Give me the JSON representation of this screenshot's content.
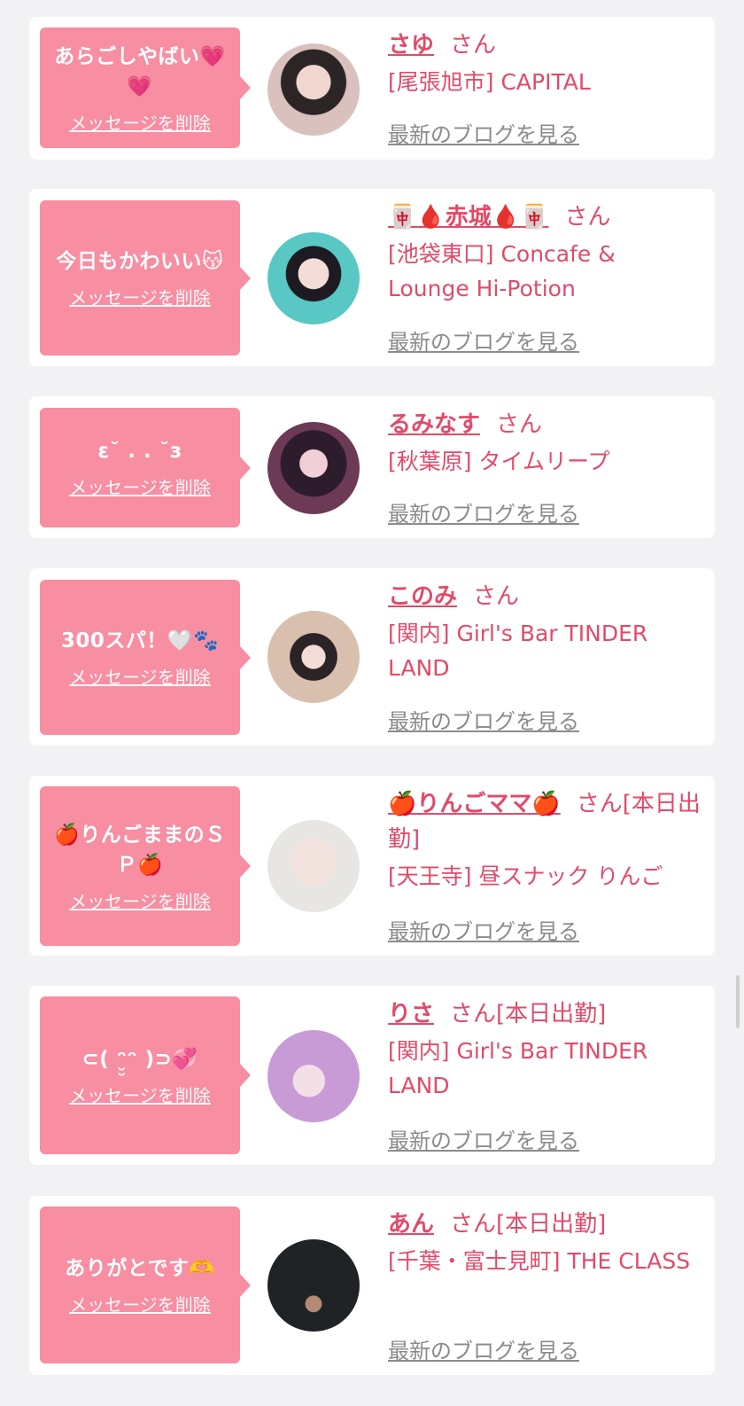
{
  "delete_label": "メッセージを削除",
  "blog_label": "最新のブログを見る",
  "san_label": "さん",
  "colors": {
    "accent": "#e14b6a",
    "bubble": "#f78ea2",
    "card": "#ffffff",
    "bg": "#f2f2f4"
  },
  "items": [
    {
      "message": "あらごしやばい💗💗",
      "name": "さゆ",
      "suffix": "",
      "shop": "[尾張旭市] CAPITAL"
    },
    {
      "message": "今日もかわいい😽",
      "name": "🀄🩸赤城🩸🀄",
      "suffix": "",
      "shop": "[池袋東口] Concafe & Lounge Hi-Potion"
    },
    {
      "message": "ε˘ . . ˘з",
      "name": "るみなす",
      "suffix": "",
      "shop": "[秋葉原] タイムリープ"
    },
    {
      "message": "300スパ！🤍🐾",
      "name": "このみ",
      "suffix": "",
      "shop": "[関内] Girl's Bar TINDER LAND"
    },
    {
      "message": "🍎りんごままのＳＰ🍎",
      "name": "🍎りんごママ🍎",
      "suffix": "[本日出勤]",
      "shop": "[天王寺] 昼スナック りんご"
    },
    {
      "message": "⊂( ᵔ̮̮ᵔ )⊃💞",
      "name": "りさ",
      "suffix": "[本日出勤]",
      "shop": "[関内] Girl's Bar TINDER LAND"
    },
    {
      "message": "ありがとです🫶",
      "name": "あん",
      "suffix": "[本日出勤]",
      "shop": "[千葉・富士見町] THE CLASS"
    }
  ]
}
